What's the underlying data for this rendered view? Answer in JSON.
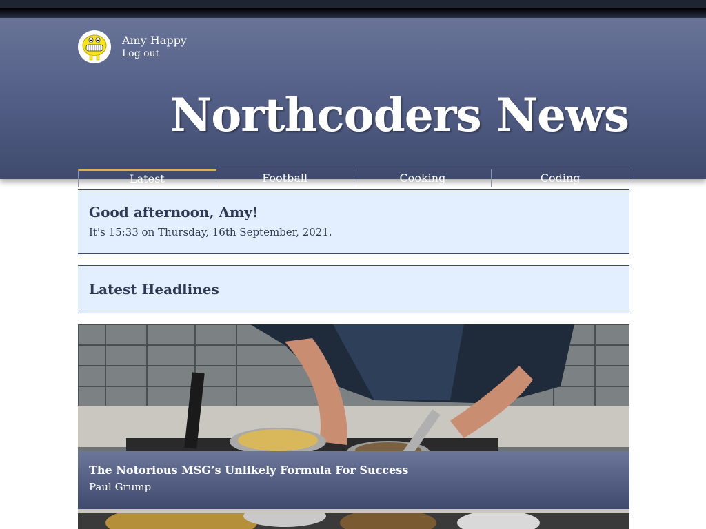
{
  "user": {
    "name": "Amy Happy",
    "logout_label": "Log out",
    "avatar_icon": "smiley-avatar-icon"
  },
  "site": {
    "title": "Northcoders News"
  },
  "nav": {
    "items": [
      {
        "label": "Latest",
        "active": true
      },
      {
        "label": "Football",
        "active": false
      },
      {
        "label": "Cooking",
        "active": false
      },
      {
        "label": "Coding",
        "active": false
      }
    ]
  },
  "greeting": {
    "title": "Good afternoon, Amy!",
    "time_text": "It's 15:33 on Thursday, 16th September, 2021."
  },
  "headlines": {
    "title": "Latest Headlines"
  },
  "articles": [
    {
      "title": "The Notorious MSG’s Unlikely Formula For Success",
      "author": "Paul Grump"
    }
  ],
  "colors": {
    "header": "#56628a",
    "panel": "#e3efff",
    "accent": "#e0b23a",
    "text_dark": "#303a56"
  }
}
